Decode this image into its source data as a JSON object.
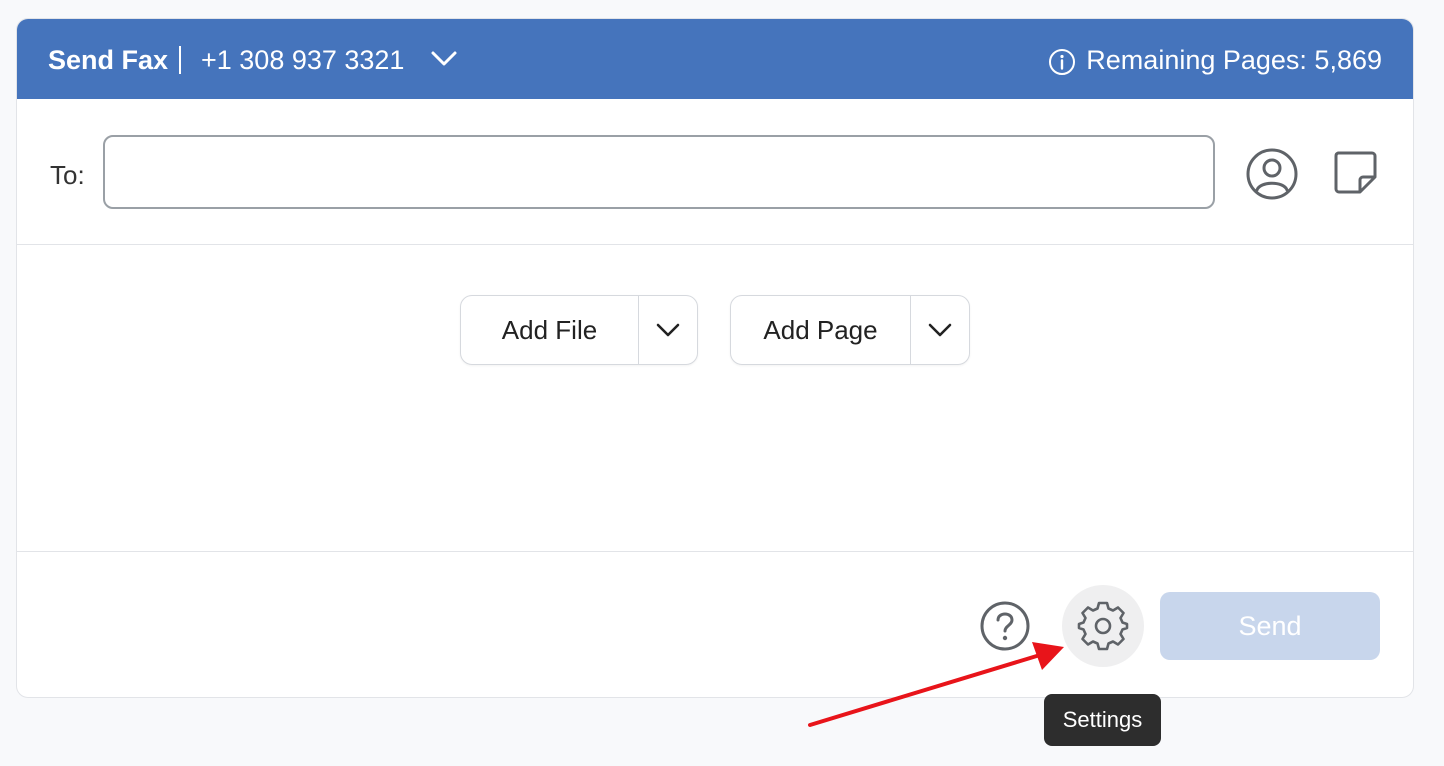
{
  "header": {
    "title": "Send Fax",
    "number": "+1 308 937 3321",
    "remaining": "Remaining Pages: 5,869",
    "color": "#4574bc"
  },
  "to": {
    "label": "To:",
    "value": "",
    "placeholder": "",
    "contact_icon": "contact-icon",
    "note_icon": "note-icon"
  },
  "actions": {
    "add_file": "Add File",
    "add_page": "Add Page"
  },
  "footer": {
    "help_icon": "help-icon",
    "settings_icon": "gear-icon",
    "send": "Send",
    "send_color": "#c8d6ec"
  },
  "tooltip": {
    "text": "Settings"
  },
  "annotation": {
    "arrow_color": "#e8141a"
  }
}
